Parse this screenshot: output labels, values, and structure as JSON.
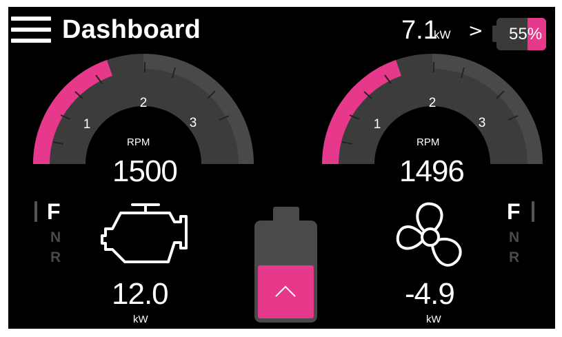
{
  "header": {
    "title": "Dashboard",
    "power_value": "7.1",
    "power_unit": "kW",
    "chevron": ">",
    "battery_text": "55%",
    "battery_level": 0.55
  },
  "left_gauge": {
    "label": "RPM",
    "value": "1500",
    "ticks": [
      "1",
      "2",
      "3"
    ],
    "fill_fraction": 0.27
  },
  "right_gauge": {
    "label": "RPM",
    "value": "1496",
    "ticks": [
      "1",
      "2",
      "3"
    ],
    "fill_fraction": 0.27
  },
  "left_gear": {
    "forward": "F",
    "neutral": "N",
    "reverse": "R"
  },
  "right_gear": {
    "forward": "F",
    "neutral": "N",
    "reverse": "R"
  },
  "engine": {
    "power": "12.0",
    "unit": "kW"
  },
  "propeller": {
    "power": "-4.9",
    "unit": "kW"
  },
  "colors": {
    "accent": "#e6398c",
    "gauge_track": "#3c3c3c",
    "gauge_rim": "#595959",
    "background": "#000000",
    "battery_body": "#4a4a4a",
    "gear_inactive": "#4a4a4a"
  },
  "icons": {
    "menu": "hamburger-menu-icon",
    "engine": "engine-icon",
    "propeller": "propeller-icon",
    "up": "chevron-up-icon"
  }
}
